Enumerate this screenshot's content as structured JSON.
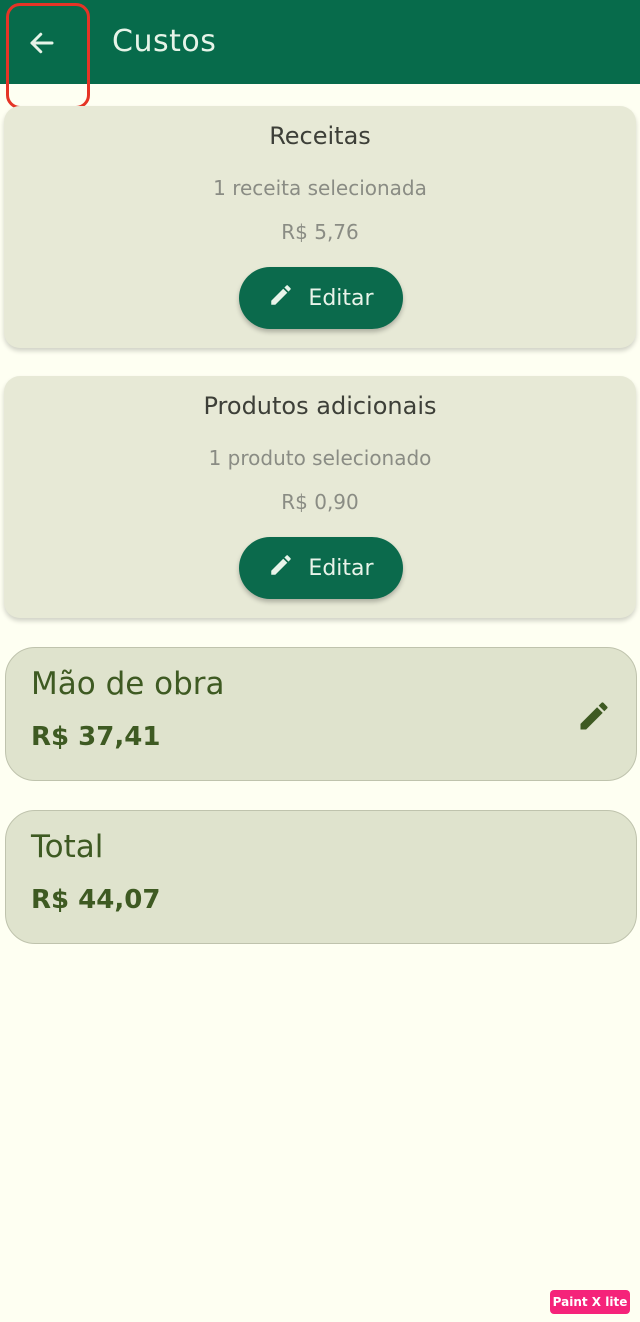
{
  "app_bar": {
    "title": "Custos",
    "back_icon": "arrow-left-icon",
    "background": "#076b4b"
  },
  "cards": [
    {
      "title": "Receitas",
      "subtitle": "1 receita selecionada",
      "price": "R$ 5,76",
      "button_label": "Editar",
      "button_icon": "pencil-icon"
    },
    {
      "title": "Produtos adicionais",
      "subtitle": "1 produto selecionado",
      "price": "R$ 0,90",
      "button_label": "Editar",
      "button_icon": "pencil-icon"
    }
  ],
  "labor": {
    "label": "Mão de obra",
    "value": "R$ 37,41",
    "edit_icon": "pencil-icon"
  },
  "total": {
    "label": "Total",
    "value": "R$ 44,07"
  },
  "watermark": {
    "text": "Paint X lite"
  },
  "colors": {
    "accent": "#076b4b",
    "highlight": "#e53426",
    "summary_text": "#3e5a22",
    "background": "#fefff2"
  }
}
